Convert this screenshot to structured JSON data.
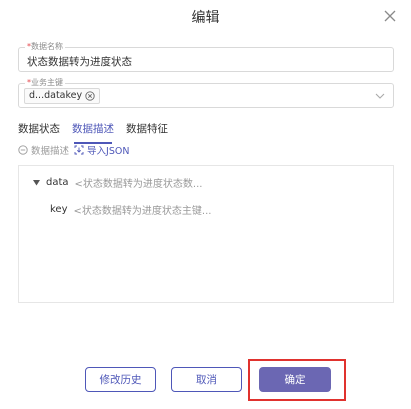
{
  "dialog": {
    "title": "编辑"
  },
  "fields": {
    "data_name": {
      "label_required": "*",
      "label": "数据名称",
      "value": "状态数据转为进度状态"
    },
    "business_key": {
      "label_required": "*",
      "label": "业务主键",
      "tag": "d...datakey"
    }
  },
  "tabs": [
    {
      "label": "数据状态",
      "active": false
    },
    {
      "label": "数据描述",
      "active": true
    },
    {
      "label": "数据特征",
      "active": false
    }
  ],
  "toolbar": {
    "collapse_label": "数据描述",
    "import_label": "导入JSON"
  },
  "tree": [
    {
      "key": "data",
      "desc": "<状态数据转为进度状态数..."
    },
    {
      "key": "key",
      "desc": "<状态数据转为进度状态主键..."
    }
  ],
  "footer": {
    "history_label": "修改历史",
    "cancel_label": "取消",
    "ok_label": "确定"
  },
  "colors": {
    "accent": "#4e57b8",
    "primary_button": "#6b67b3",
    "highlight": "#e0322e",
    "required": "#e5484d"
  }
}
